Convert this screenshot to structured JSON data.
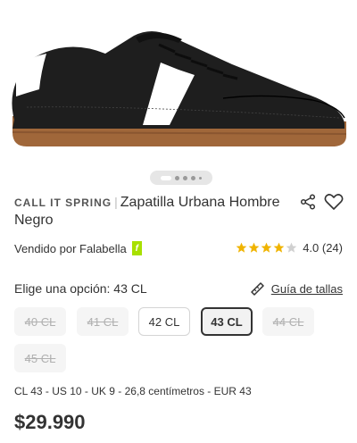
{
  "product": {
    "brand": "CALL IT SPRING",
    "separator": "|",
    "name": "Zapatilla Urbana Hombre Negro",
    "seller_prefix": "Vendido por Falabella",
    "seller_badge": "f",
    "rating_value": "4.0 (24)",
    "rating_stars": 4,
    "price": "$29.990"
  },
  "gallery": {
    "current_index": 1,
    "total_dots": 5
  },
  "sizes": {
    "option_label": "Elige una opción: 43 CL",
    "guide_label": "Guía de tallas",
    "items": [
      {
        "label": "40 CL",
        "state": "disabled"
      },
      {
        "label": "41 CL",
        "state": "disabled"
      },
      {
        "label": "42 CL",
        "state": "available"
      },
      {
        "label": "43 CL",
        "state": "selected"
      },
      {
        "label": "44 CL",
        "state": "disabled"
      },
      {
        "label": "45 CL",
        "state": "disabled"
      }
    ],
    "equivalence": "CL 43 - US 10 - UK 9 - 26,8 centímetros - EUR 43"
  },
  "colors": {
    "accent_star": "#f0b400",
    "seller_badge": "#a8e000",
    "shoe_upper": "#1e1e1e",
    "shoe_sole": "#a0673a"
  }
}
